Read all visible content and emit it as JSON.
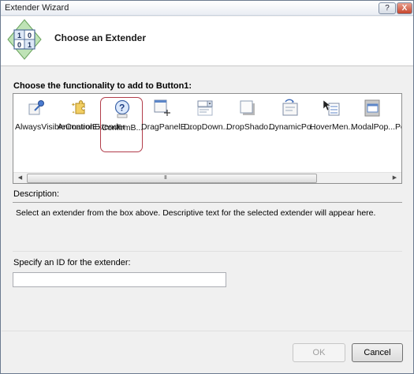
{
  "window": {
    "title": "Extender Wizard",
    "help_label": "?",
    "close_label": "X"
  },
  "header": {
    "title": "Choose an Extender",
    "icon_cells": [
      "1",
      "0",
      "0",
      "1"
    ]
  },
  "extenders": {
    "label": "Choose the functionality to add to Button1:",
    "items": [
      {
        "label": "AlwaysVisibleControlExtender",
        "icon": "pin-icon"
      },
      {
        "label": "AnimationE...",
        "icon": "puzzle-star-icon"
      },
      {
        "label": "ConfirmB...",
        "icon": "question-icon",
        "selected": true
      },
      {
        "label": "DragPanelE...",
        "icon": "drag-panel-icon"
      },
      {
        "label": "DropDown...",
        "icon": "dropdown-icon"
      },
      {
        "label": "DropShado...",
        "icon": "dropshadow-icon"
      },
      {
        "label": "DynamicPo...",
        "icon": "dynamic-populate-icon"
      },
      {
        "label": "HoverMen...",
        "icon": "hover-menu-icon"
      },
      {
        "label": "ModalPop...",
        "icon": "modal-popup-icon"
      },
      {
        "label": "Po",
        "icon": "popup-icon"
      }
    ],
    "scroll_grip": "III"
  },
  "description": {
    "label": "Description:",
    "text": "Select an extender from the box above.  Descriptive text for the selected extender will appear here."
  },
  "id_field": {
    "label": "Specify an ID for the extender:",
    "value": ""
  },
  "buttons": {
    "ok": "OK",
    "cancel": "Cancel"
  }
}
